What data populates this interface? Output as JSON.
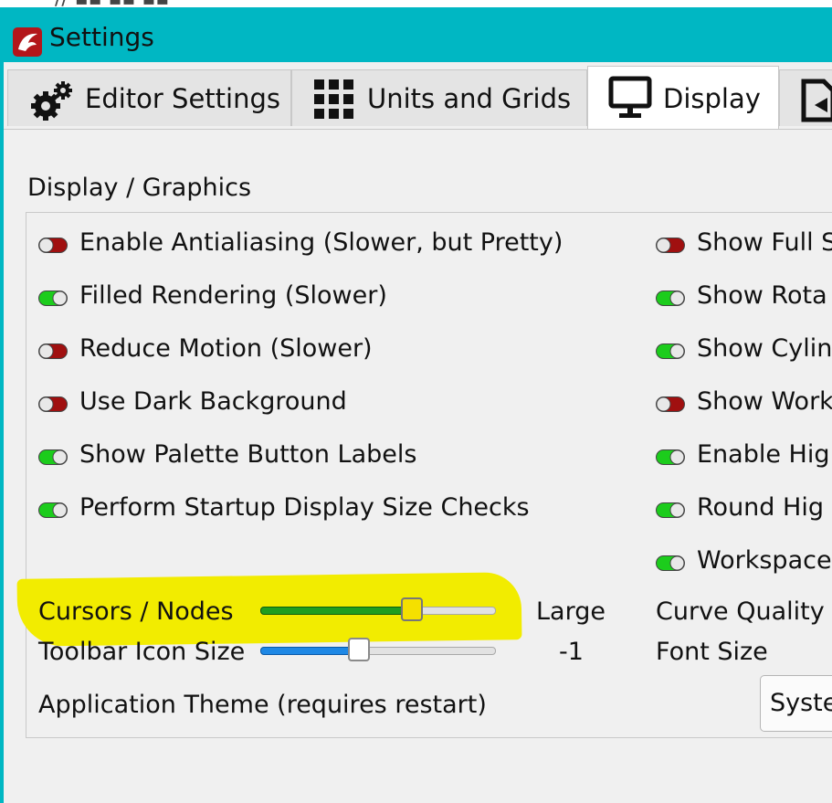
{
  "window": {
    "title": "Settings"
  },
  "tabs": [
    {
      "label": "Editor Settings",
      "icon": "gears-icon",
      "active": false
    },
    {
      "label": "Units and Grids",
      "icon": "grid-icon",
      "active": false
    },
    {
      "label": "Display",
      "icon": "monitor-icon",
      "active": true
    },
    {
      "label": "",
      "icon": "import-icon",
      "active": false
    }
  ],
  "display": {
    "group_title": "Display / Graphics",
    "left_options": [
      {
        "label": "Enable Antialiasing (Slower, but Pretty)",
        "on": false
      },
      {
        "label": "Filled Rendering (Slower)",
        "on": true
      },
      {
        "label": "Reduce Motion (Slower)",
        "on": false
      },
      {
        "label": "Use Dark Background",
        "on": false
      },
      {
        "label": "Show Palette Button Labels",
        "on": true
      },
      {
        "label": "Perform Startup Display Size Checks",
        "on": true
      }
    ],
    "right_options": [
      {
        "label": "Show Full S",
        "on": false
      },
      {
        "label": "Show Rota",
        "on": true
      },
      {
        "label": "Show Cylin",
        "on": true
      },
      {
        "label": "Show Work",
        "on": false
      },
      {
        "label": "Enable Hig",
        "on": true
      },
      {
        "label": "Round Hig",
        "on": true
      },
      {
        "label": "Workspace",
        "on": true
      }
    ],
    "cursors_nodes": {
      "label": "Cursors / Nodes",
      "value_text": "Large",
      "level": 0.66
    },
    "toolbar_icon_size": {
      "label": "Toolbar Icon Size",
      "value_text": "-1",
      "level": 0.41
    },
    "curve_quality_label": "Curve Quality",
    "font_size_label": "Font Size",
    "app_theme": {
      "label": "Application Theme (requires restart)",
      "selected": "Syste"
    }
  },
  "colors": {
    "titlebar": "#00b7c3",
    "toggle_on": "#1ccc1c",
    "toggle_off": "#a01010",
    "highlight": "#f2ec00",
    "slider_green": "#1f9e1f",
    "slider_blue": "#1e88e5"
  }
}
